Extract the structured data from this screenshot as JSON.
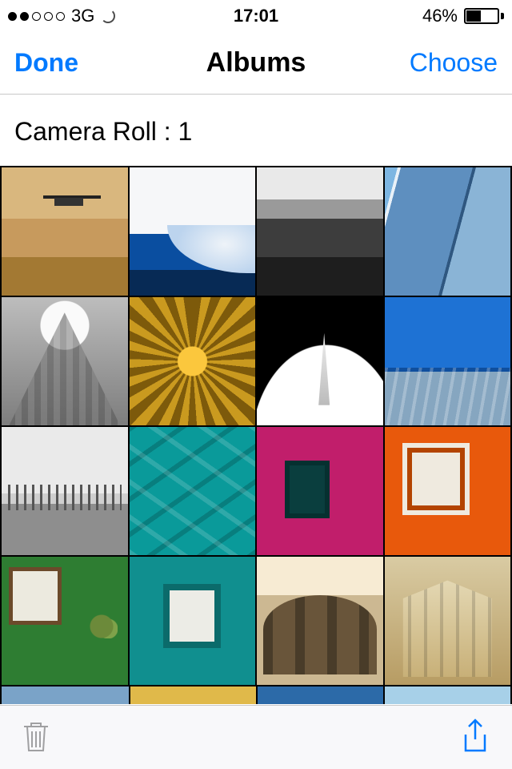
{
  "status": {
    "carrier": "3G",
    "time": "17:01",
    "battery_pct": "46%"
  },
  "nav": {
    "left": "Done",
    "title": "Albums",
    "right": "Choose"
  },
  "album": {
    "label": "Camera Roll : 1"
  },
  "toolbar": {
    "trash_enabled": false,
    "share_enabled": true
  }
}
